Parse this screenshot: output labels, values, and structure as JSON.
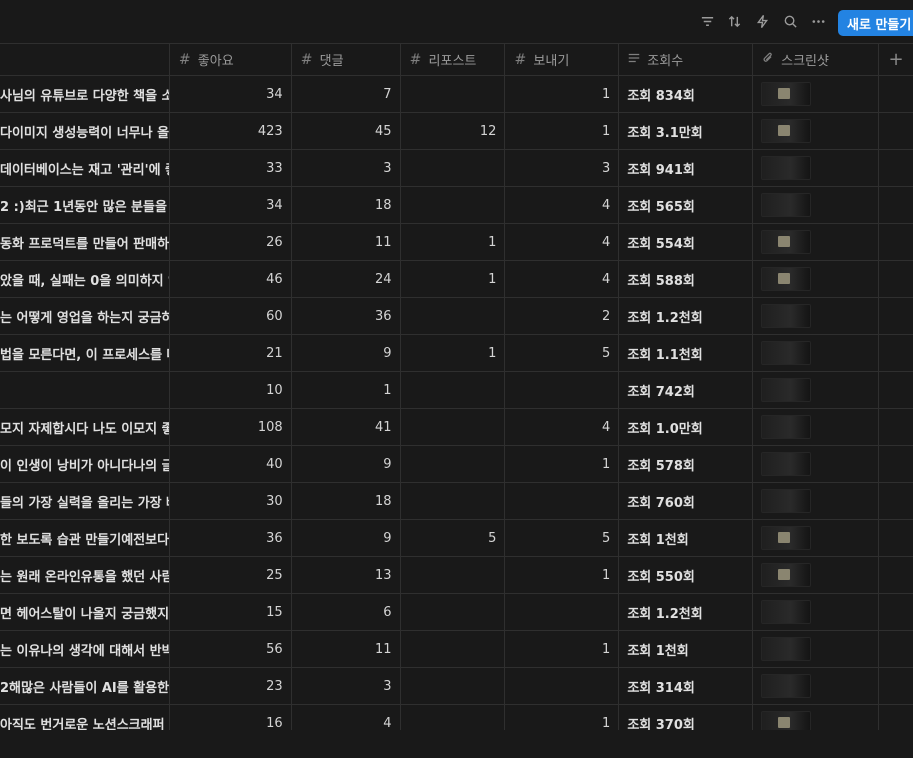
{
  "toolbar": {
    "icons": [
      "filter-icon",
      "sort-icon",
      "lightning-icon",
      "search-icon",
      "more-icon"
    ],
    "new_button_label": "새로 만들기"
  },
  "columns": {
    "likes": "좋아요",
    "comments": "댓글",
    "reposts": "리포스트",
    "sends": "보내기",
    "views": "조회수",
    "screenshot": "스크린샷",
    "add": "+"
  },
  "rows": [
    {
      "title": "사님의 유튜브로 다양한 책을 소",
      "likes": "34",
      "comments": "7",
      "reposts": "",
      "sends": "1",
      "views": "조회 834회",
      "thumb": "light"
    },
    {
      "title": "다이미지 생성능력이 너무나 올라",
      "likes": "423",
      "comments": "45",
      "reposts": "12",
      "sends": "1",
      "views": "조회 3.1만회",
      "thumb": "light"
    },
    {
      "title": "데이터베이스는 재고 '관리'에 좋",
      "likes": "33",
      "comments": "3",
      "reposts": "",
      "sends": "3",
      "views": "조회 941회",
      "thumb": "dark"
    },
    {
      "title": "2 :)최근 1년동안 많은 분들을 만",
      "likes": "34",
      "comments": "18",
      "reposts": "",
      "sends": "4",
      "views": "조회 565회",
      "thumb": "dark"
    },
    {
      "title": "동화 프로덕트를 만들어 판매하시",
      "likes": "26",
      "comments": "11",
      "reposts": "1",
      "sends": "4",
      "views": "조회 554회",
      "thumb": "light"
    },
    {
      "title": "았을 때, 실패는 0을 의미하지 않는",
      "likes": "46",
      "comments": "24",
      "reposts": "1",
      "sends": "4",
      "views": "조회 588회",
      "thumb": "light"
    },
    {
      "title": "는 어떻게 영업을 하는지 궁금하",
      "likes": "60",
      "comments": "36",
      "reposts": "",
      "sends": "2",
      "views": "조회 1.2천회",
      "thumb": "dark"
    },
    {
      "title": "법을 모른다면, 이 프로세스를 따",
      "likes": "21",
      "comments": "9",
      "reposts": "1",
      "sends": "5",
      "views": "조회 1.1천회",
      "thumb": "dark"
    },
    {
      "title": "",
      "likes": "10",
      "comments": "1",
      "reposts": "",
      "sends": "",
      "views": "조회 742회",
      "thumb": "dark"
    },
    {
      "title": "모지 자제합시다 나도 이모지 좋",
      "likes": "108",
      "comments": "41",
      "reposts": "",
      "sends": "4",
      "views": "조회 1.0만회",
      "thumb": "dark"
    },
    {
      "title": "이 인생이 낭비가 아니다나의 글",
      "likes": "40",
      "comments": "9",
      "reposts": "",
      "sends": "1",
      "views": "조회 578회",
      "thumb": "dark"
    },
    {
      "title": "들의 가장 실력을 올리는 가장 빠",
      "likes": "30",
      "comments": "18",
      "reposts": "",
      "sends": "",
      "views": "조회 760회",
      "thumb": "dark"
    },
    {
      "title": "한 보도록 습관 만들기예전보다 유",
      "likes": "36",
      "comments": "9",
      "reposts": "5",
      "sends": "5",
      "views": "조회 1천회",
      "thumb": "light"
    },
    {
      "title": "는 원래 온라인유통을 했던 사람이",
      "likes": "25",
      "comments": "13",
      "reposts": "",
      "sends": "1",
      "views": "조회 550회",
      "thumb": "light"
    },
    {
      "title": "면 헤어스탈이 나올지 궁금했지만",
      "likes": "15",
      "comments": "6",
      "reposts": "",
      "sends": "",
      "views": "조회 1.2천회",
      "thumb": "dark"
    },
    {
      "title": "는 이유나의 생각에 대해서 반박하",
      "likes": "56",
      "comments": "11",
      "reposts": "",
      "sends": "1",
      "views": "조회 1천회",
      "thumb": "dark"
    },
    {
      "title": "2해많은 사람들이 AI를 활용한 기",
      "likes": "23",
      "comments": "3",
      "reposts": "",
      "sends": "",
      "views": "조회 314회",
      "thumb": "dark"
    },
    {
      "title": "아직도 번거로운 노션스크래퍼 사",
      "likes": "16",
      "comments": "4",
      "reposts": "",
      "sends": "1",
      "views": "조회 370회",
      "thumb": "light"
    }
  ]
}
